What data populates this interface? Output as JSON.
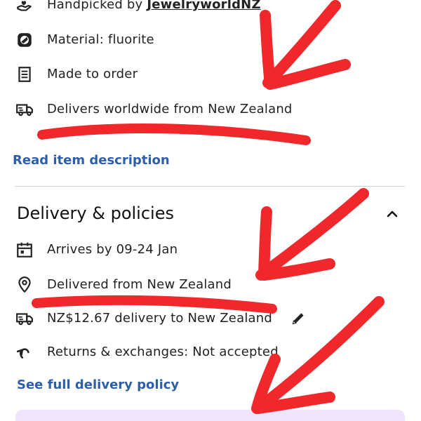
{
  "item_details": {
    "handpicked_prefix": "Handpicked by ",
    "shop_name": "JewelryworldNZ",
    "material": "Material: fluorite",
    "made_to_order": "Made to order",
    "ships_from": "Delivers worldwide from New Zealand",
    "read_description_link": "Read item description"
  },
  "delivery": {
    "section_title": "Delivery & policies",
    "arrives": "Arrives by 09-24 Jan",
    "delivered_from": "Delivered from New Zealand",
    "delivery_cost": "NZ$12.67 delivery to New Zealand",
    "returns": "Returns & exchanges: Not accepted",
    "full_policy_link": "See full delivery policy"
  },
  "icons": {
    "handpicked": "hand-heart-icon",
    "material": "material-icon",
    "made_to_order": "document-icon",
    "delivery": "delivery-truck-icon",
    "arrives": "calendar-icon",
    "location": "location-pin-icon",
    "returns": "return-arrow-icon",
    "collapse": "chevron-up-icon",
    "edit": "pencil-icon"
  },
  "colors": {
    "link": "#2f5ea8",
    "text": "#222222",
    "annotation": "#f0272b",
    "promo_background": "#eee4fb"
  }
}
